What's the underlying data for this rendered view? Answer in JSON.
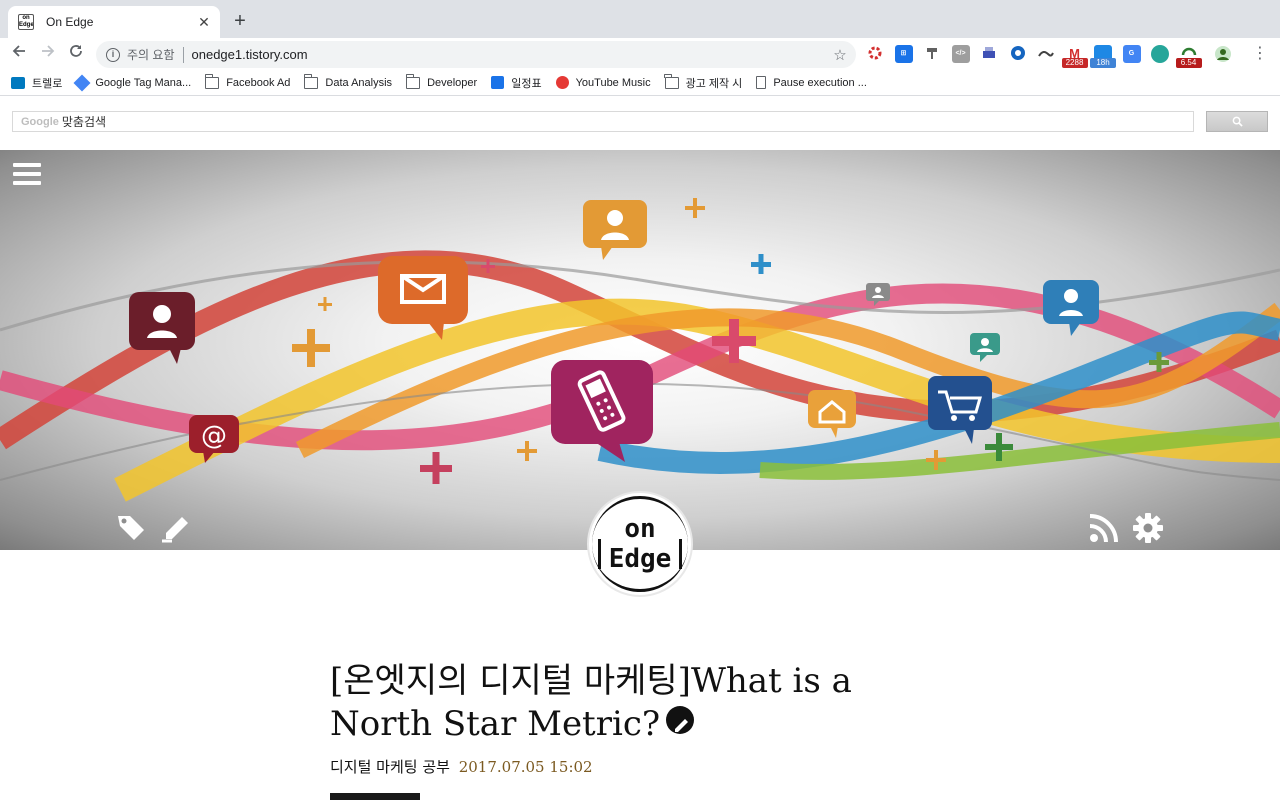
{
  "browser": {
    "tab": {
      "favicon_text": "on Edge",
      "title": "On Edge"
    },
    "address": {
      "security_text": "주의 요함",
      "url": "onedge1.tistory.com"
    },
    "extension_badges": {
      "gmail": "2288",
      "calendar": "18h",
      "last": "6.54"
    },
    "bookmarks": [
      {
        "label": "트렐로",
        "icon": "trello-icon"
      },
      {
        "label": "Google Tag Mana...",
        "icon": "tag-manager-icon"
      },
      {
        "label": "Facebook Ad",
        "icon": "folder-icon"
      },
      {
        "label": "Data Analysis",
        "icon": "folder-icon"
      },
      {
        "label": "Developer",
        "icon": "folder-icon"
      },
      {
        "label": "일정표",
        "icon": "calendar-icon"
      },
      {
        "label": "YouTube Music",
        "icon": "youtube-music-icon"
      },
      {
        "label": "광고 제작 시",
        "icon": "folder-icon"
      },
      {
        "label": "Pause execution ...",
        "icon": "page-icon"
      }
    ]
  },
  "search": {
    "logo": "Google",
    "label": "맞춤검색"
  },
  "blog": {
    "logo_line1": "on",
    "logo_line2": "Edge"
  },
  "post": {
    "title": "[온엣지의 디지털 마케팅]What is a North Star Metric?",
    "category": "디지털 마케팅 공부",
    "date": "2017.07.05 15:02"
  },
  "colors": {
    "accent_date": "#7b5a21",
    "hero_ribbon_red": "#d2443a",
    "hero_ribbon_yellow": "#f2c42c",
    "hero_ribbon_blue": "#2f8fc9"
  }
}
